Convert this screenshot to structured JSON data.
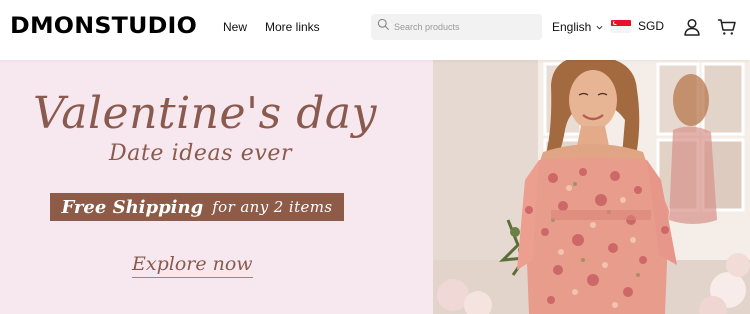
{
  "header": {
    "logo": "DMONSTUDIO",
    "nav": [
      {
        "label": "New"
      },
      {
        "label": "More links"
      }
    ],
    "search": {
      "placeholder": "Search products",
      "icon": "search-icon"
    },
    "language": {
      "label": "English"
    },
    "currency": {
      "label": "SGD",
      "flag": "singapore-flag-icon"
    },
    "icons": [
      "account-icon",
      "cart-icon"
    ]
  },
  "hero": {
    "headline": "Valentine's day",
    "subhead": "Date ideas ever",
    "shipping_main": "Free Shipping",
    "shipping_rest": "for any 2 items",
    "cta": "Explore now",
    "colors": {
      "panel_bg": "#f7e8ef",
      "text": "#8a5a4e",
      "ribbon": "#8d5b48"
    }
  }
}
